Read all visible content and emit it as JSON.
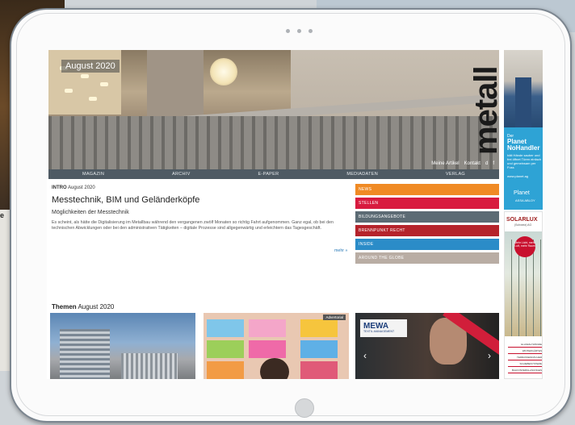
{
  "background": {
    "side_text": "e"
  },
  "hero": {
    "date": "August 2020",
    "logo": "metall",
    "links": [
      "Meine Artikel",
      "Kontakt",
      "d",
      "f"
    ]
  },
  "nav": [
    "MAGAZIN",
    "ARCHIV",
    "E-PAPER",
    "MEDIADATEN",
    "VERLAG"
  ],
  "intro": {
    "kicker_label": "INTRO",
    "kicker_date": "August 2020",
    "title": "Messtechnik, BIM und Geländerköpfe",
    "subtitle": "Möglichkeiten der Messtechnik",
    "text": "Es scheint, als hätte die Digitalisierung im Metallbau während den vergangenen zwölf Monaten so richtig Fahrt aufgenommen. Ganz egal, ob bei den technischen Abwicklungen oder bei den administrativen Tätigkeiten – digitale Prozesse sind allgegenwärtig und erleichtern das Tagesgeschäft.",
    "more": "mehr »"
  },
  "categories": [
    {
      "label": "NEWS",
      "color": "#f08a24"
    },
    {
      "label": "STELLEN",
      "color": "#d81b3f"
    },
    {
      "label": "BILDUNGSANGEBOTE",
      "color": "#5c6b74"
    },
    {
      "label": "BRENNPUNKT RECHT",
      "color": "#b5232b"
    },
    {
      "label": "INSIDE",
      "color": "#2b8cc8"
    },
    {
      "label": "AROUND THE GLOBE",
      "color": "#b9ada4"
    }
  ],
  "themes": {
    "label": "Themen",
    "date": "August 2020",
    "card2_badge": "Advertorial",
    "mewa_name": "MEWA",
    "mewa_sub": "TEXTIL-MANAGEMENT"
  },
  "ads": {
    "planet": {
      "kicker": "Der",
      "title_1": "Planet",
      "title_2": "NoHandler",
      "body": "hält Hände sauber und frei öffnet Türen einfach und gemeinsam per Fuss",
      "url": "www.planet.ag",
      "brand": "Planet",
      "brand_sub": "ASSA ABLOY"
    },
    "solarlux": {
      "brand": "SOLARLUX",
      "sub": "(Schweiz) AG",
      "circle": "Mehr Licht, mehr Luft, mehr Raum",
      "list": [
        "GLASFALTWÄNDE",
        "WINTERGÄRTEN",
        "TERRASSENDÄCHER",
        "SCHIEBESYSTEME",
        "BALKONVERGLASUNGEN"
      ]
    }
  }
}
